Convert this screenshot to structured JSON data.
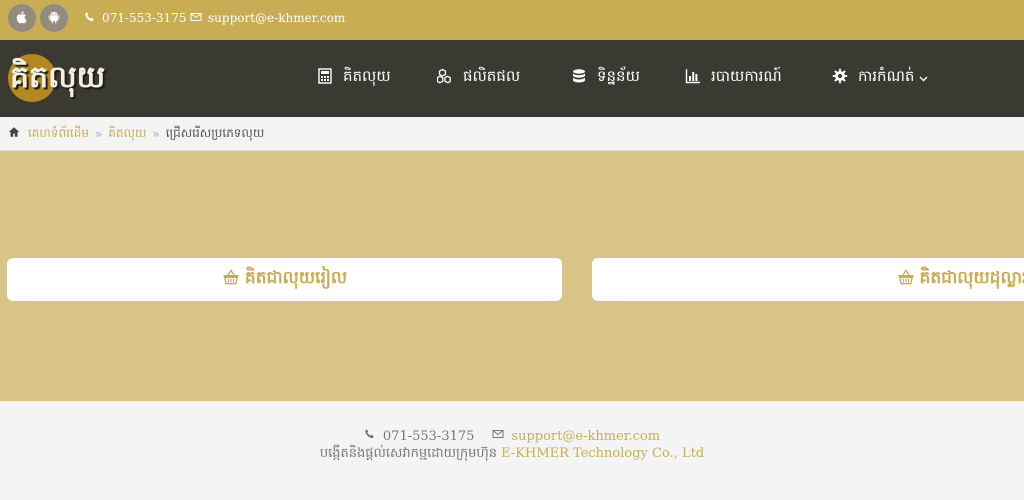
{
  "topbar": {
    "os_icons": [
      "apple-icon",
      "android-icon"
    ],
    "phone": "071-553-3175",
    "email": "support@e-khmer.com"
  },
  "navbar": {
    "logo_text": "គិតលុយ",
    "items": [
      {
        "label": "គិតលុយ",
        "icon": "calculator-icon"
      },
      {
        "label": "ផលិតផល",
        "icon": "cubes-icon"
      },
      {
        "label": "ទិន្នន័យ",
        "icon": "database-icon"
      },
      {
        "label": "របាយការណ៍",
        "icon": "bar-chart-icon"
      },
      {
        "label": "ការកំណត់",
        "icon": "gear-icon",
        "dropdown": true
      }
    ]
  },
  "breadcrumb": {
    "home": "គេហទំព័រដើម",
    "parent": "គិតលុយ",
    "current": "ជ្រើសរើសប្រភេទលុយ",
    "separator": "»"
  },
  "main": {
    "choices": [
      {
        "label": "គិតជាលុយរៀល",
        "icon": "basket-icon"
      },
      {
        "label": "គិតជាលុយដុល្លារ",
        "icon": "basket-icon"
      }
    ]
  },
  "footer": {
    "phone": "071-553-3175",
    "email": "support@e-khmer.com",
    "credit_prefix": "បង្កើតនិងផ្តល់សេវាកម្មដោយក្រុមហ៊ុន",
    "company": "E-KHMER Technology Co., Ltd"
  },
  "colors": {
    "topbar": "#c9ad55",
    "navbar": "#3b3a32",
    "main_bg": "#d8c487",
    "accent": "#c9ad55",
    "footer_bg": "#f4f4f4"
  }
}
